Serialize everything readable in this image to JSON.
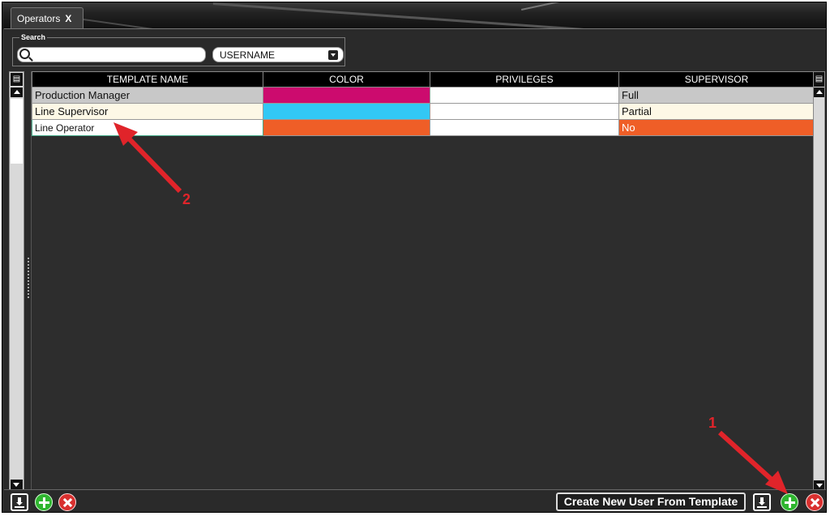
{
  "tab": {
    "label": "Operators",
    "close": "X"
  },
  "search": {
    "legend": "Search",
    "value": "",
    "field_selected": "USERNAME"
  },
  "table": {
    "columns": [
      "TEMPLATE NAME",
      "COLOR",
      "PRIVILEGES",
      "SUPERVISOR"
    ],
    "rows": [
      {
        "template_name": "Production Manager",
        "color": "#cc0b6e",
        "privileges": "",
        "supervisor": "Full"
      },
      {
        "template_name": "Line Supervisor",
        "color": "#32c8f5",
        "privileges": "",
        "supervisor": "Partial"
      },
      {
        "template_name": "Line Operator",
        "color": "#ef5e27",
        "privileges": "",
        "supervisor": "No"
      }
    ]
  },
  "bottombar": {
    "create_label": "Create New User From Template"
  },
  "annotations": {
    "label_1": "1",
    "label_2": "2"
  },
  "colors": {
    "accent_red": "#e0242a",
    "add_green": "#2fb52f",
    "delete_red": "#d9302f"
  }
}
